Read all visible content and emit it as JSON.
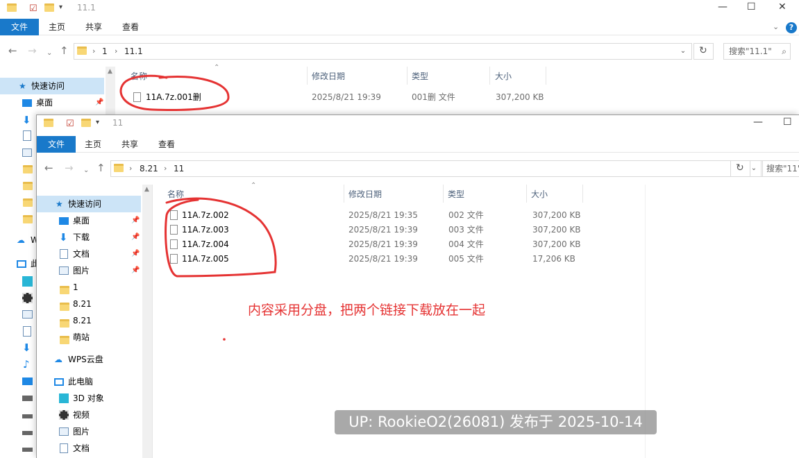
{
  "back": {
    "title": "11.1",
    "ribbon": [
      "文件",
      "主页",
      "共享",
      "查看"
    ],
    "breadcrumb": [
      "1",
      "11.1"
    ],
    "search_placeholder": "搜索\"11.1\"",
    "columns": [
      "名称",
      "修改日期",
      "类型",
      "大小"
    ],
    "files": [
      {
        "name": "11A.7z.001删",
        "date": "2025/8/21 19:39",
        "type": "001删 文件",
        "size": "307,200 KB"
      }
    ],
    "nav": [
      {
        "label": "快速访问",
        "icon": "star-icon"
      },
      {
        "label": "桌面",
        "icon": "desktop-icon"
      },
      {
        "label": "W",
        "icon": "cloud-icon"
      },
      {
        "label": "此",
        "icon": "pc-icon"
      }
    ]
  },
  "front": {
    "title": "11",
    "ribbon": [
      "文件",
      "主页",
      "共享",
      "查看"
    ],
    "breadcrumb": [
      "8.21",
      "11"
    ],
    "search_placeholder": "搜索\"11\"",
    "columns": [
      "名称",
      "修改日期",
      "类型",
      "大小"
    ],
    "files": [
      {
        "name": "11A.7z.002",
        "date": "2025/8/21 19:35",
        "type": "002 文件",
        "size": "307,200 KB"
      },
      {
        "name": "11A.7z.003",
        "date": "2025/8/21 19:39",
        "type": "003 文件",
        "size": "307,200 KB"
      },
      {
        "name": "11A.7z.004",
        "date": "2025/8/21 19:39",
        "type": "004 文件",
        "size": "307,200 KB"
      },
      {
        "name": "11A.7z.005",
        "date": "2025/8/21 19:39",
        "type": "005 文件",
        "size": "17,206 KB"
      }
    ],
    "nav": [
      {
        "label": "快速访问",
        "icon": "star-icon"
      },
      {
        "label": "桌面",
        "icon": "desktop-icon"
      },
      {
        "label": "下载",
        "icon": "download-icon"
      },
      {
        "label": "文档",
        "icon": "document-icon"
      },
      {
        "label": "图片",
        "icon": "picture-icon"
      },
      {
        "label": "1",
        "icon": "folder-icon"
      },
      {
        "label": "8.21",
        "icon": "folder-icon"
      },
      {
        "label": "8.21",
        "icon": "folder-icon"
      },
      {
        "label": "萌站",
        "icon": "folder-icon"
      },
      {
        "label": "WPS云盘",
        "icon": "cloud-icon"
      },
      {
        "label": "此电脑",
        "icon": "pc-icon"
      },
      {
        "label": "3D 对象",
        "icon": "3d-object-icon"
      },
      {
        "label": "视频",
        "icon": "video-icon"
      },
      {
        "label": "图片",
        "icon": "picture-icon"
      },
      {
        "label": "文档",
        "icon": "document-icon"
      }
    ]
  },
  "annotation": "内容采用分盘，把两个链接下载放在一起",
  "watermark": "UP: RookieO2(26081) 发布于 2025-10-14",
  "colors": {
    "accent": "#1979ca",
    "annotation": "#e53333",
    "selection": "#cce4f7"
  }
}
